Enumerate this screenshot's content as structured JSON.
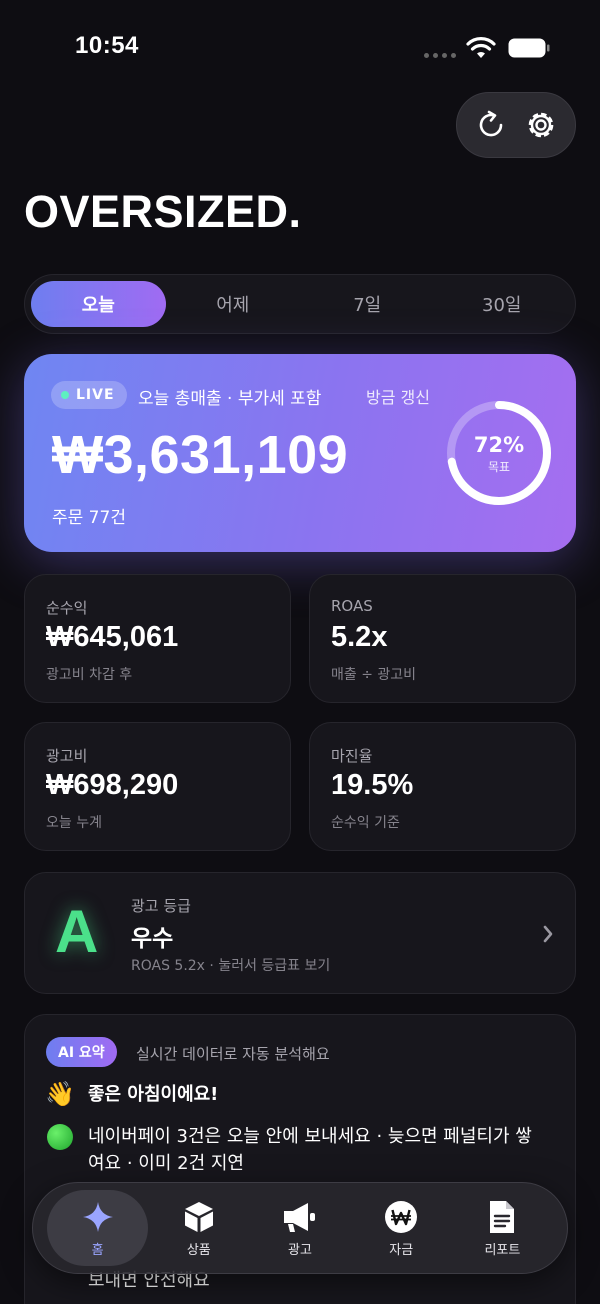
{
  "status_bar": {
    "time": "10:54"
  },
  "brand": "OVERSIZED.",
  "period_tabs": [
    {
      "label": "오늘",
      "active": true
    },
    {
      "label": "어제",
      "active": false
    },
    {
      "label": "7일",
      "active": false
    },
    {
      "label": "30일",
      "active": false
    }
  ],
  "hero": {
    "live_label": "LIVE",
    "title": "오늘 총매출 · 부가세 포함",
    "refreshed": "방금 갱신",
    "amount": "₩3,631,109",
    "orders": "주문 77건",
    "goal_percent": "72%",
    "goal_progress": 0.72,
    "goal_label": "목표"
  },
  "stats": [
    {
      "label": "순수익",
      "value": "₩645,061",
      "sub": "광고비 차감 후"
    },
    {
      "label": "ROAS",
      "value": "5.2x",
      "sub": "매출 ÷ 광고비"
    },
    {
      "label": "광고비",
      "value": "₩698,290",
      "sub": "오늘 누계"
    },
    {
      "label": "마진율",
      "value": "19.5%",
      "sub": "순수익 기준"
    }
  ],
  "grade": {
    "letter": "A",
    "label": "광고 등급",
    "value": "우수",
    "sub": "ROAS 5.2x · 눌러서 등급표 보기"
  },
  "ai_summary": {
    "badge": "AI 요약",
    "caption": "실시간 데이터로 자동 분석해요",
    "greeting": "좋은 아침이에요!",
    "alert": "네이버페이 3건은 오늘 안에 보내세요 · 늦으면 페널티가 쌓여요 · 이미 2건 지연",
    "partial": "보내면 안전해요"
  },
  "tabbar": [
    {
      "label": "홈",
      "icon": "sparkle-icon",
      "active": true
    },
    {
      "label": "상품",
      "icon": "box-icon",
      "active": false
    },
    {
      "label": "광고",
      "icon": "megaphone-icon",
      "active": false
    },
    {
      "label": "자금",
      "icon": "won-coin-icon",
      "active": false
    },
    {
      "label": "리포트",
      "icon": "document-icon",
      "active": false
    }
  ],
  "colors": {
    "background": "#0e0d12",
    "accent_start": "#6e7ef0",
    "accent_end": "#a06bf2",
    "grade_green": "#4be08a",
    "live_dot": "#5ef0c0"
  }
}
